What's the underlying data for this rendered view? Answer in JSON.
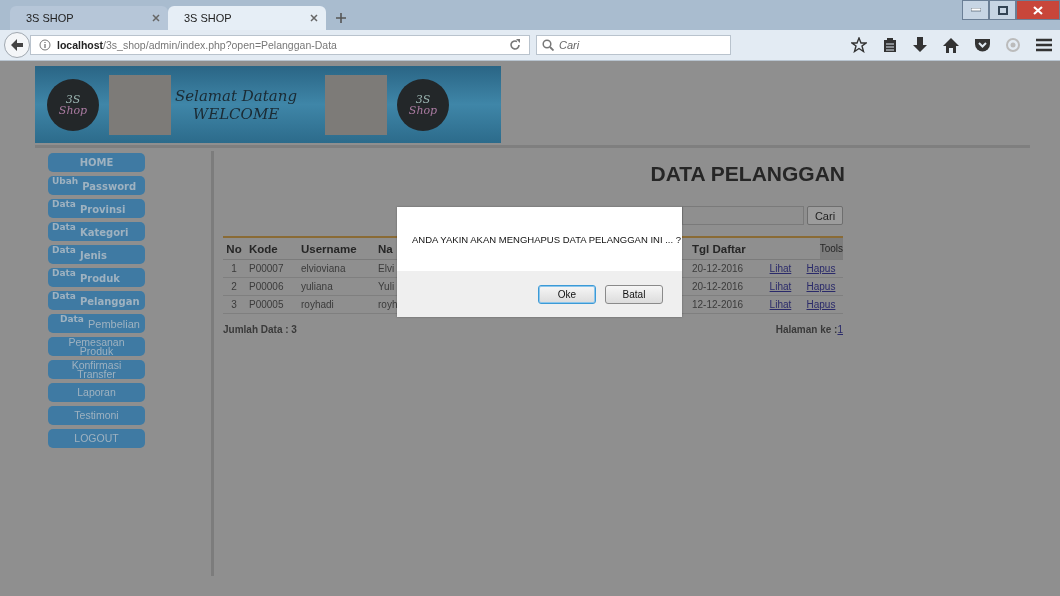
{
  "browser": {
    "tabs": [
      {
        "title": "3S SHOP",
        "selected": false
      },
      {
        "title": "3S SHOP",
        "selected": true
      }
    ],
    "url_host": "localhost",
    "url_path": "/3s_shop/admin/index.php?open=Pelanggan-Data",
    "search_placeholder": "Cari"
  },
  "banner": {
    "logos": [
      {
        "lines": [
          "3S",
          "Shop"
        ]
      },
      {
        "lines": [
          "3S",
          "Shop"
        ]
      }
    ],
    "greeting": "Selamat Datang",
    "welcome": "WELCOME"
  },
  "sidebar": {
    "items": [
      {
        "kind": "bold",
        "label": "HOME"
      },
      {
        "kind": "bold",
        "prefix": "Ubah",
        "label": "Password"
      },
      {
        "kind": "bold",
        "prefix": "Data",
        "label": "Provinsi"
      },
      {
        "kind": "bold",
        "prefix": "Data",
        "label": "Kategori"
      },
      {
        "kind": "bold",
        "prefix": "Data",
        "label": "Jenis"
      },
      {
        "kind": "bold",
        "prefix": "Data",
        "label": "Produk"
      },
      {
        "kind": "bold",
        "prefix": "Data",
        "label": "Pelanggan"
      },
      {
        "kind": "plain",
        "prefix": "Data",
        "label": "Pembelian"
      },
      {
        "kind": "plain",
        "label": "Pemesanan Produk"
      },
      {
        "kind": "plain",
        "label": "Konfirmasi Transfer"
      },
      {
        "kind": "plain",
        "label": "Laporan"
      },
      {
        "kind": "plain",
        "label": "Testimoni"
      },
      {
        "kind": "plain",
        "label": "LOGOUT"
      }
    ]
  },
  "content": {
    "title": "DATA PELANGGAN",
    "search_button": "Cari",
    "table": {
      "columns": [
        "No",
        "Kode",
        "Username",
        "Na",
        "Tgl Daftar",
        "Tools"
      ],
      "rows": [
        {
          "cells": [
            "1",
            "P00007",
            "elvioviana",
            "Elvi",
            "20-12-2016"
          ],
          "actions": [
            "Lihat",
            "Hapus"
          ]
        },
        {
          "cells": [
            "2",
            "P00006",
            "yuliana",
            "Yuli",
            "20-12-2016"
          ],
          "actions": [
            "Lihat",
            "Hapus"
          ]
        },
        {
          "cells": [
            "3",
            "P00005",
            "royhadi",
            "royh",
            "12-12-2016"
          ],
          "actions": [
            "Lihat",
            "Hapus"
          ]
        }
      ]
    },
    "total": "Jumlah Data : 3",
    "page_label": "Halaman ke : ",
    "page_link": "1"
  },
  "dialog": {
    "message": "ANDA YAKIN AKAN MENGHAPUS DATA PELANGGAN INI ... ?",
    "buttons": [
      {
        "label": "Oke",
        "selected": true
      },
      {
        "label": "Batal",
        "selected": false
      }
    ]
  }
}
